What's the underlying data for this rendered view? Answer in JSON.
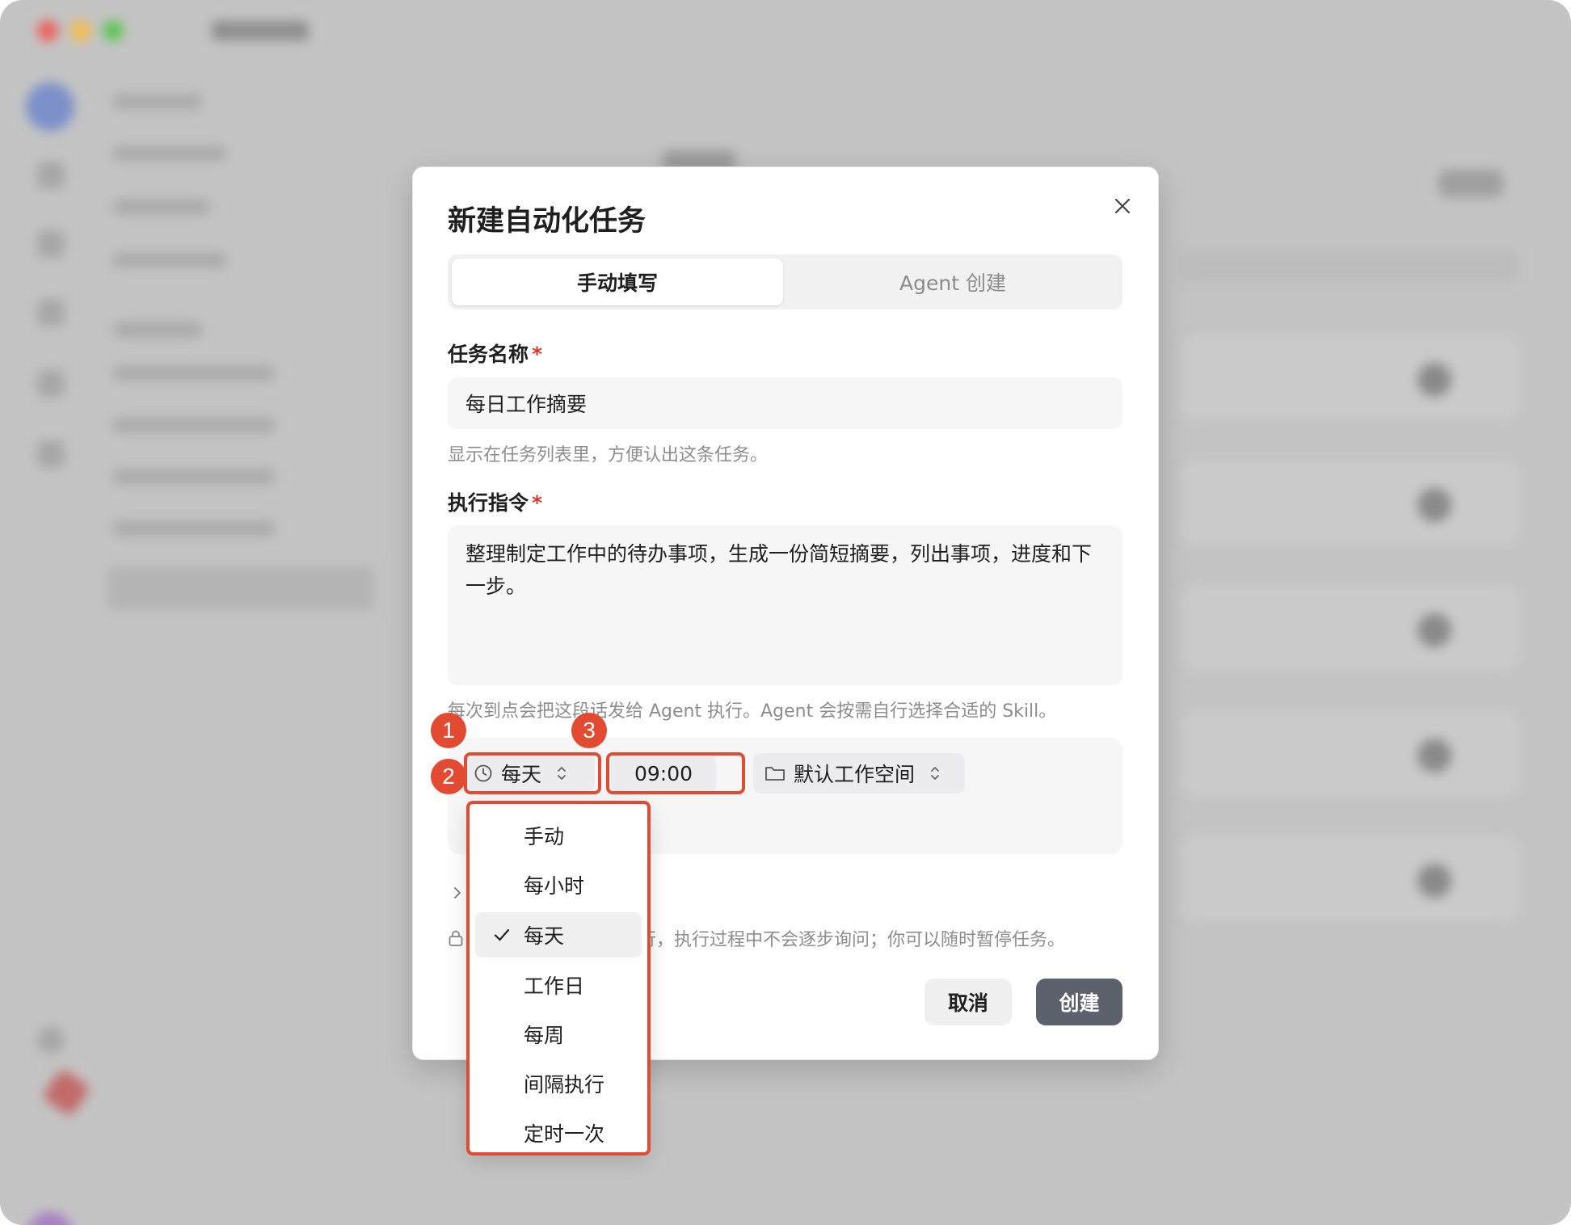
{
  "dialog": {
    "title": "新建自动化任务",
    "tabs": [
      {
        "label": "手动填写",
        "active": true
      },
      {
        "label": "Agent 创建",
        "active": false
      }
    ],
    "task_name": {
      "label": "任务名称",
      "required_mark": "*",
      "value": "每日工作摘要",
      "hint": "显示在任务列表里，方便认出这条任务。"
    },
    "instruction": {
      "label": "执行指令",
      "required_mark": "*",
      "value": "整理制定工作中的待办事项，生成一份简短摘要，列出事项，进度和下一步。",
      "hint": "每次到点会把这段话发给 Agent 执行。Agent 会按需自行选择合适的 Skill。"
    },
    "schedule": {
      "frequency": "每天",
      "time": "09:00",
      "workspace": "默认工作空间"
    },
    "permission_note_visible": "行，执行过程中不会逐步询问；你可以随时暂停任务。",
    "buttons": {
      "cancel": "取消",
      "create": "创建"
    }
  },
  "frequency_dropdown": {
    "options": [
      "手动",
      "每小时",
      "每天",
      "工作日",
      "每周",
      "间隔执行",
      "定时一次"
    ],
    "selected": "每天",
    "check_mark": "✓"
  },
  "annotations": [
    "1",
    "2",
    "3"
  ],
  "colors": {
    "highlight": "#e24a32",
    "primary_button": "#5d616c",
    "required": "#d53a2d",
    "traffic_red": "#ed5f57",
    "traffic_yellow": "#f4bd4f",
    "traffic_green": "#5fc454"
  },
  "icons": {
    "close": "close-icon",
    "frequency": "clock-icon",
    "workspace": "folder-icon",
    "selector": "chevron-up-down-icon",
    "expand": "chevron-right-icon",
    "permission": "lock-icon"
  }
}
